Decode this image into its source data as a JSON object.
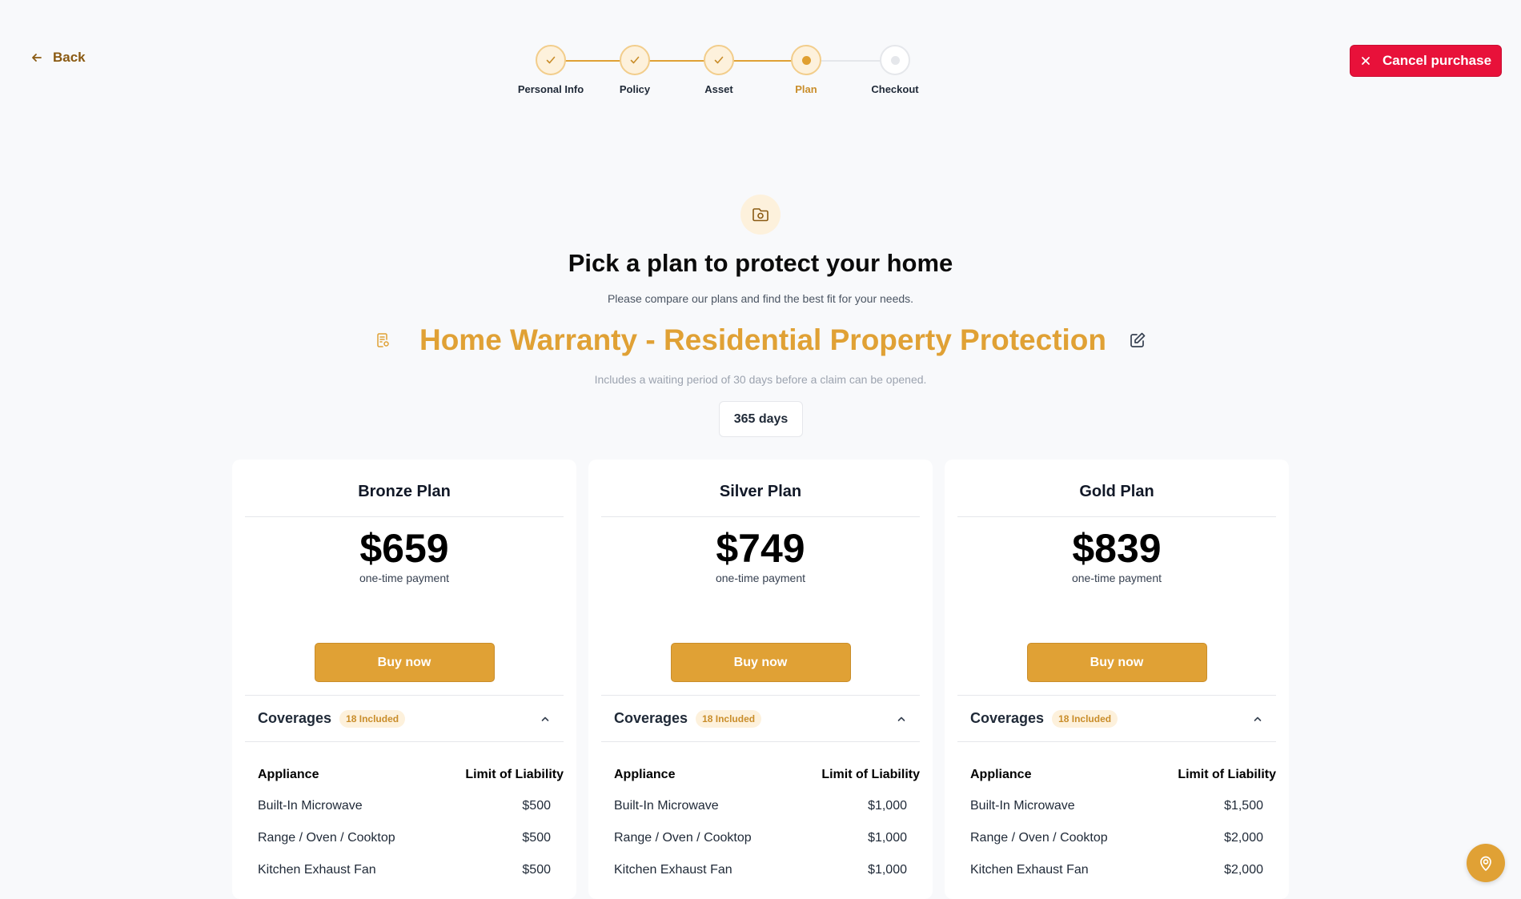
{
  "header": {
    "back_label": "Back",
    "cancel_label": "Cancel purchase"
  },
  "stepper": {
    "steps": [
      {
        "label": "Personal Info",
        "state": "done"
      },
      {
        "label": "Policy",
        "state": "done"
      },
      {
        "label": "Asset",
        "state": "done"
      },
      {
        "label": "Plan",
        "state": "active"
      },
      {
        "label": "Checkout",
        "state": "todo"
      }
    ]
  },
  "hero": {
    "icon": "camera-folder-icon",
    "title": "Pick a plan to protect your home",
    "subtitle": "Please compare our plans and find the best fit for your needs.",
    "product_title": "Home Warranty - Residential Property Protection",
    "waiting_note": "Includes a waiting period of 30 days before a claim can be opened.",
    "duration": "365 days"
  },
  "plans": [
    {
      "name": "Bronze Plan",
      "price": "$659",
      "price_note": "one-time payment",
      "buy_label": "Buy now",
      "coverages_label": "Coverages",
      "coverages_badge": "18 Included",
      "col_appliance": "Appliance",
      "col_limit": "Limit of Liability",
      "rows": [
        {
          "name": "Built-In Microwave",
          "limit": "$500"
        },
        {
          "name": "Range / Oven / Cooktop",
          "limit": "$500"
        },
        {
          "name": "Kitchen Exhaust Fan",
          "limit": "$500"
        }
      ]
    },
    {
      "name": "Silver Plan",
      "price": "$749",
      "price_note": "one-time payment",
      "buy_label": "Buy now",
      "coverages_label": "Coverages",
      "coverages_badge": "18 Included",
      "col_appliance": "Appliance",
      "col_limit": "Limit of Liability",
      "rows": [
        {
          "name": "Built-In Microwave",
          "limit": "$1,000"
        },
        {
          "name": "Range / Oven / Cooktop",
          "limit": "$1,000"
        },
        {
          "name": "Kitchen Exhaust Fan",
          "limit": "$1,000"
        }
      ]
    },
    {
      "name": "Gold Plan",
      "price": "$839",
      "price_note": "one-time payment",
      "buy_label": "Buy now",
      "coverages_label": "Coverages",
      "coverages_badge": "18 Included",
      "col_appliance": "Appliance",
      "col_limit": "Limit of Liability",
      "rows": [
        {
          "name": "Built-In Microwave",
          "limit": "$1,500"
        },
        {
          "name": "Range / Oven / Cooktop",
          "limit": "$2,000"
        },
        {
          "name": "Kitchen Exhaust Fan",
          "limit": "$2,000"
        }
      ]
    }
  ],
  "colors": {
    "accent": "#e0a135",
    "accent_light": "#fdf1dc",
    "danger": "#e8113a",
    "back_text": "#8a5a12",
    "background": "#f8f9fb"
  },
  "fab": {
    "icon": "help-pin-icon"
  }
}
